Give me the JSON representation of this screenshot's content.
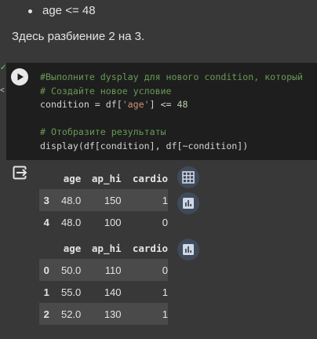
{
  "markdown": {
    "bullet": "age <= 48",
    "paragraph": "Здесь разбиение 2 на 3."
  },
  "code": {
    "line1": "#Выполните dysplay для нового condition, который",
    "line2": "# Создайте новое условие",
    "line3_a": "condition = df[",
    "line3_str": "'age'",
    "line3_b": "] <= ",
    "line3_num": "48",
    "line5": "# Отобразите результаты",
    "line6": "display(df[condition], df[~condition])"
  },
  "table1": {
    "headers": [
      "age",
      "ap_hi",
      "cardio"
    ],
    "rows": [
      {
        "index": "3",
        "age": "48.0",
        "ap_hi": "150",
        "cardio": "1"
      },
      {
        "index": "4",
        "age": "48.0",
        "ap_hi": "100",
        "cardio": "0"
      }
    ]
  },
  "table2": {
    "headers": [
      "age",
      "ap_hi",
      "cardio"
    ],
    "rows": [
      {
        "index": "0",
        "age": "50.0",
        "ap_hi": "110",
        "cardio": "0"
      },
      {
        "index": "1",
        "age": "55.0",
        "ap_hi": "140",
        "cardio": "1"
      },
      {
        "index": "2",
        "age": "52.0",
        "ap_hi": "130",
        "cardio": "1"
      }
    ]
  },
  "icons": {
    "run": "play-icon",
    "output": "output-redirect-icon",
    "table": "table-grid-icon",
    "chart": "bar-chart-icon"
  }
}
